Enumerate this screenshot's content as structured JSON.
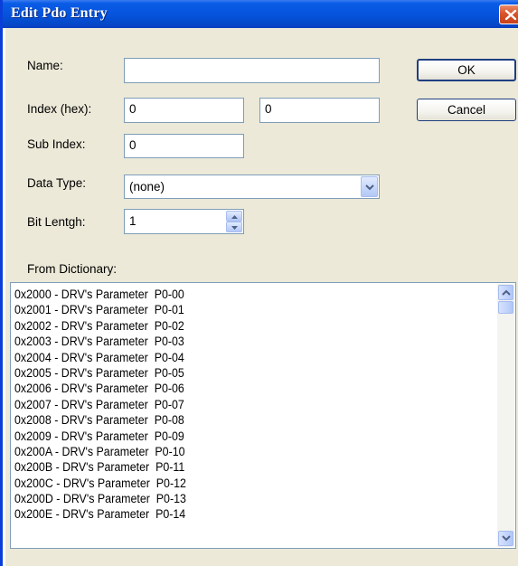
{
  "window": {
    "title": "Edit Pdo Entry"
  },
  "form": {
    "name_label": "Name:",
    "name_value": "",
    "index_label": "Index (hex):",
    "index_value": "0",
    "index_second_value": "0",
    "subindex_label": "Sub Index:",
    "subindex_value": "0",
    "datatype_label": "Data Type:",
    "datatype_value": "(none)",
    "bitlength_label": "Bit Lentgh:",
    "bitlength_value": "1",
    "dictionary_label": "From Dictionary:"
  },
  "buttons": {
    "ok_label": "OK",
    "cancel_label": "Cancel"
  },
  "dictionary": {
    "items": [
      "0x2000 - DRV's Parameter  P0-00",
      "0x2001 - DRV's Parameter  P0-01",
      "0x2002 - DRV's Parameter  P0-02",
      "0x2003 - DRV's Parameter  P0-03",
      "0x2004 - DRV's Parameter  P0-04",
      "0x2005 - DRV's Parameter  P0-05",
      "0x2006 - DRV's Parameter  P0-06",
      "0x2007 - DRV's Parameter  P0-07",
      "0x2008 - DRV's Parameter  P0-08",
      "0x2009 - DRV's Parameter  P0-09",
      "0x200A - DRV's Parameter  P0-10",
      "0x200B - DRV's Parameter  P0-11",
      "0x200C - DRV's Parameter  P0-12",
      "0x200D - DRV's Parameter  P0-13",
      "0x200E - DRV's Parameter  P0-14"
    ]
  },
  "icons": {
    "close": "close-icon",
    "combo_arrow": "chevron-down-icon",
    "spin_up": "chevron-up-icon",
    "spin_down": "chevron-down-icon",
    "scroll_up": "chevron-up-icon",
    "scroll_down": "chevron-down-icon"
  },
  "colors": {
    "titlebar": "#0653dc",
    "dialog_background": "#ece9d8",
    "close_button": "#d9542a"
  }
}
